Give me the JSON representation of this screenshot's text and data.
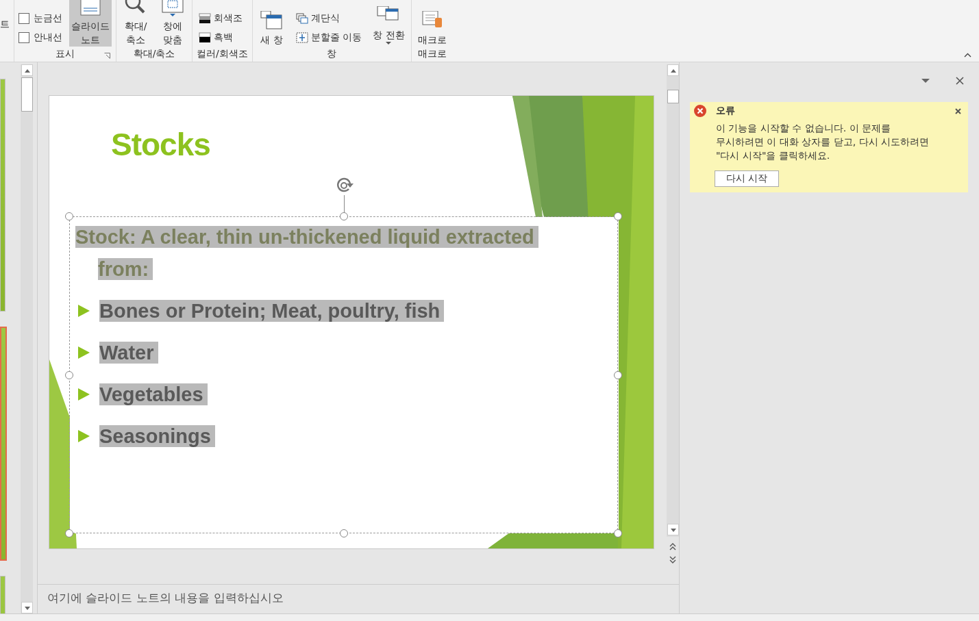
{
  "ribbon": {
    "left_fragment": "트",
    "groups": [
      {
        "label": "표시",
        "launcher": true,
        "items": [
          {
            "kind": "checks",
            "checks": [
              {
                "label": "눈금선",
                "checked": false
              },
              {
                "label": "안내선",
                "checked": false
              }
            ]
          },
          {
            "kind": "large",
            "lines": [
              "슬라이드",
              "노트"
            ],
            "selected": true,
            "dropdown": false
          }
        ]
      },
      {
        "label": "확대/축소",
        "launcher": false,
        "items": [
          {
            "kind": "large",
            "lines": [
              "확대/",
              "축소"
            ],
            "selected": false,
            "dropdown": false
          },
          {
            "kind": "large",
            "lines": [
              "창에",
              "맞춤"
            ],
            "selected": false,
            "dropdown": false
          }
        ]
      },
      {
        "label": "컬러/회색조",
        "launcher": false,
        "items": [
          {
            "kind": "smalls",
            "smalls": [
              {
                "label": "회색조"
              },
              {
                "label": "흑백"
              }
            ]
          }
        ]
      },
      {
        "label": "창",
        "launcher": false,
        "items": [
          {
            "kind": "large",
            "lines": [
              "새 창"
            ],
            "selected": false,
            "dropdown": false
          },
          {
            "kind": "smalls",
            "smalls": [
              {
                "label": "계단식"
              },
              {
                "label": "분할줄 이동"
              }
            ]
          },
          {
            "kind": "large",
            "lines": [
              "창 전환"
            ],
            "selected": false,
            "dropdown": true
          }
        ]
      },
      {
        "label": "매크로",
        "launcher": false,
        "items": [
          {
            "kind": "large",
            "lines": [
              "매크로"
            ],
            "selected": false,
            "dropdown": false
          }
        ]
      }
    ]
  },
  "thumbnails": [
    {
      "selected": false
    },
    {
      "selected": true
    },
    {
      "selected": false
    }
  ],
  "slide": {
    "title": "Stocks",
    "paragraphs": [
      {
        "kind": "lead",
        "text": "Stock: A clear, thin un-thickened liquid extracted from:"
      },
      {
        "kind": "bullet",
        "text": "Bones or Protein; Meat, poultry, fish"
      },
      {
        "kind": "bullet",
        "text": "Water"
      },
      {
        "kind": "bullet",
        "text": "Vegetables"
      },
      {
        "kind": "bullet",
        "text": "Seasonings"
      }
    ]
  },
  "notes": {
    "placeholder": "여기에 슬라이드 노트의 내용을 입력하십시오"
  },
  "error": {
    "title": "오류",
    "message_lines": [
      "이 기능을 시작할 수 없습니다. 이 문제를",
      "무시하려면 이 대화 상자를 닫고, 다시 시도하려면",
      "\"다시 시작\"을 클릭하세요."
    ],
    "button": "다시 시작"
  }
}
